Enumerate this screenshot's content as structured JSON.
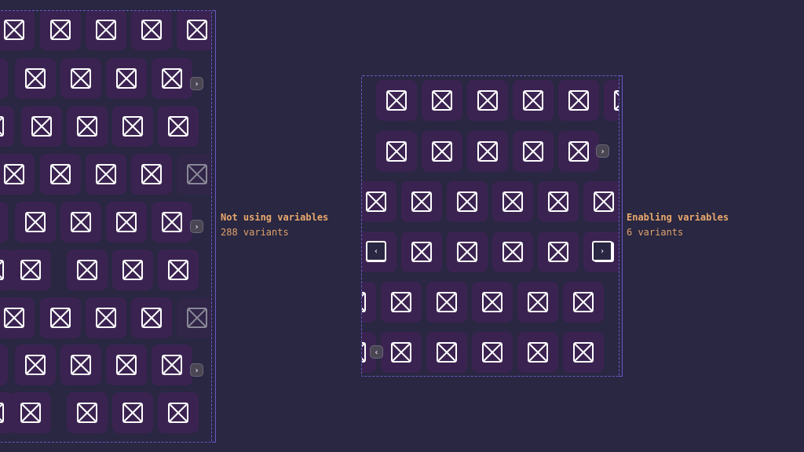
{
  "panels": [
    {
      "id": "not-using-variables",
      "title": "Not using variables",
      "subtitle": "288 variants"
    },
    {
      "id": "enabling-variables",
      "title": "Enabling variables",
      "subtitle": "6 variants"
    }
  ],
  "icons": {
    "tile_icon": "image-placeholder-icon",
    "next_icon": "chevron-right-icon",
    "prev_icon": "chevron-left-icon"
  },
  "nav_glyphs": {
    "next": "›",
    "prev": "‹"
  },
  "colors": {
    "background": "#292742",
    "tile": "#3b2351",
    "frame_border": "#6d57c9",
    "label": "#e8a86b",
    "icon_stroke": "#ffffff"
  }
}
